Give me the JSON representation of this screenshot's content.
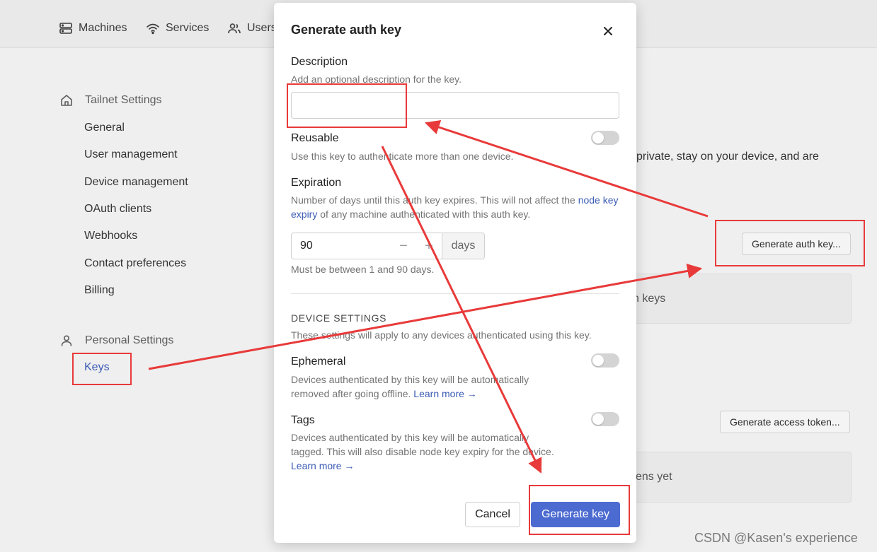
{
  "topnav": {
    "items": [
      {
        "label": "Machines",
        "icon": "server-icon"
      },
      {
        "label": "Services",
        "icon": "wifi-icon"
      },
      {
        "label": "Users",
        "icon": "users-icon"
      }
    ]
  },
  "sidebar": {
    "tailnet_heading": "Tailnet Settings",
    "tailnet_items": [
      "General",
      "User management",
      "Device management",
      "OAuth clients",
      "Webhooks",
      "Contact preferences",
      "Billing"
    ],
    "personal_heading": "Personal Settings",
    "personal_items": [
      "Keys"
    ]
  },
  "background": {
    "intro_text": "private, stay on your device, and are",
    "generate_auth_key_button": "Generate auth key...",
    "auth_keys_empty": "n keys",
    "generate_access_token_button": "Generate access token...",
    "access_tokens_empty": "kens yet"
  },
  "modal": {
    "title": "Generate auth key",
    "description": {
      "label": "Description",
      "hint": "Add an optional description for the key.",
      "value": "",
      "placeholder": ""
    },
    "reusable": {
      "label": "Reusable",
      "hint": "Use this key to authenticate more than one device.",
      "enabled": false
    },
    "expiration": {
      "label": "Expiration",
      "hint_before": "Number of days until this auth key expires. This will not affect the ",
      "hint_link": "node key expiry",
      "hint_after": " of any machine authenticated with this auth key.",
      "value": "90",
      "unit": "days",
      "minus": "−",
      "plus": "+",
      "constraint": "Must be between 1 and 90 days."
    },
    "device_settings": {
      "title": "DEVICE SETTINGS",
      "hint": "These settings will apply to any devices authenticated using this key."
    },
    "ephemeral": {
      "label": "Ephemeral",
      "hint_line1": "Devices authenticated by this key will be automatically",
      "hint_line2": "removed after going offline. ",
      "link": "Learn more →",
      "enabled": false
    },
    "tags": {
      "label": "Tags",
      "hint_line1": "Devices authenticated by this key will be automatically",
      "hint_line2": "tagged. This will also disable node key expiry for the device.",
      "link": "Learn more →",
      "enabled": false
    },
    "cancel_label": "Cancel",
    "generate_label": "Generate key"
  },
  "annotation_color": "#e83a3a",
  "accent_color": "#4c6bd1",
  "watermark": "CSDN @Kasen's experience"
}
